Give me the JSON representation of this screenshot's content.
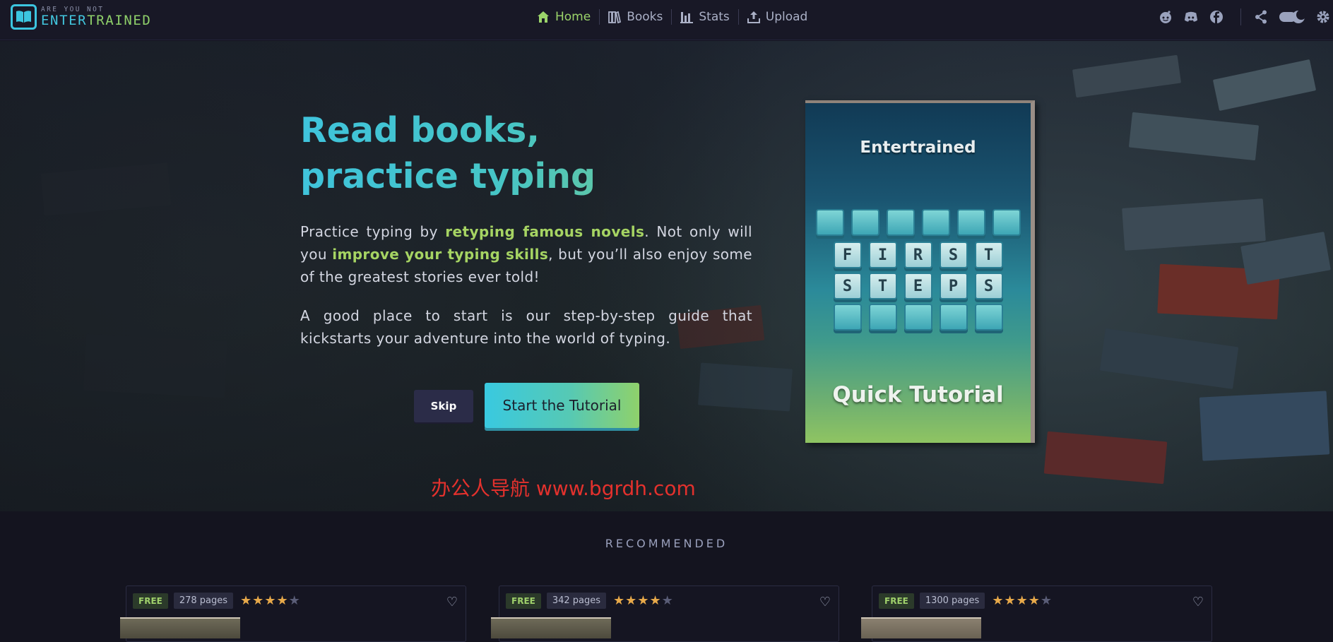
{
  "logo": {
    "small": "ARE YOU NOT",
    "big_1": "ENTER",
    "big_2": "TRAINED"
  },
  "nav": [
    {
      "label": "Home",
      "icon": "home-icon",
      "active": true
    },
    {
      "label": "Books",
      "icon": "books-icon",
      "active": false
    },
    {
      "label": "Stats",
      "icon": "stats-icon",
      "active": false
    },
    {
      "label": "Upload",
      "icon": "upload-icon",
      "active": false
    }
  ],
  "top_right_icons": [
    "reddit-icon",
    "discord-icon",
    "facebook-icon",
    "share-icon",
    "theme-toggle-icon",
    "settings-icon"
  ],
  "hero": {
    "title_line1": "Read books,",
    "title_line2": "practice typing",
    "p1_a": "Practice typing by ",
    "p1_hl1": "retyping famous novels",
    "p1_b": ". Not only will you ",
    "p1_hl2": "improve your typing skills",
    "p1_c": ", but you’ll also enjoy some of the greatest stories ever told!",
    "p2": "A good place to start is our step-by-step guide that kickstarts your adventure into the world of typing.",
    "skip_label": "Skip",
    "start_label": "Start the Tutorial"
  },
  "cover": {
    "title": "Entertrained",
    "row1": [
      "F",
      "I",
      "R",
      "S",
      "T"
    ],
    "row2": [
      "S",
      "T",
      "E",
      "P",
      "S"
    ],
    "subtitle": "Quick Tutorial"
  },
  "watermark": "办公人导航 www.bgrdh.com",
  "recommended": {
    "title": "RECOMMENDED",
    "cards": [
      {
        "tag": "FREE",
        "pages": "278 pages",
        "rating": 4.5
      },
      {
        "tag": "FREE",
        "pages": "342 pages",
        "rating": 4.5
      },
      {
        "tag": "FREE",
        "pages": "1300 pages",
        "rating": 4.5
      }
    ]
  },
  "colors": {
    "accent_green": "#9bd46a",
    "accent_cyan": "#3fc4dd",
    "background": "#14141f"
  }
}
